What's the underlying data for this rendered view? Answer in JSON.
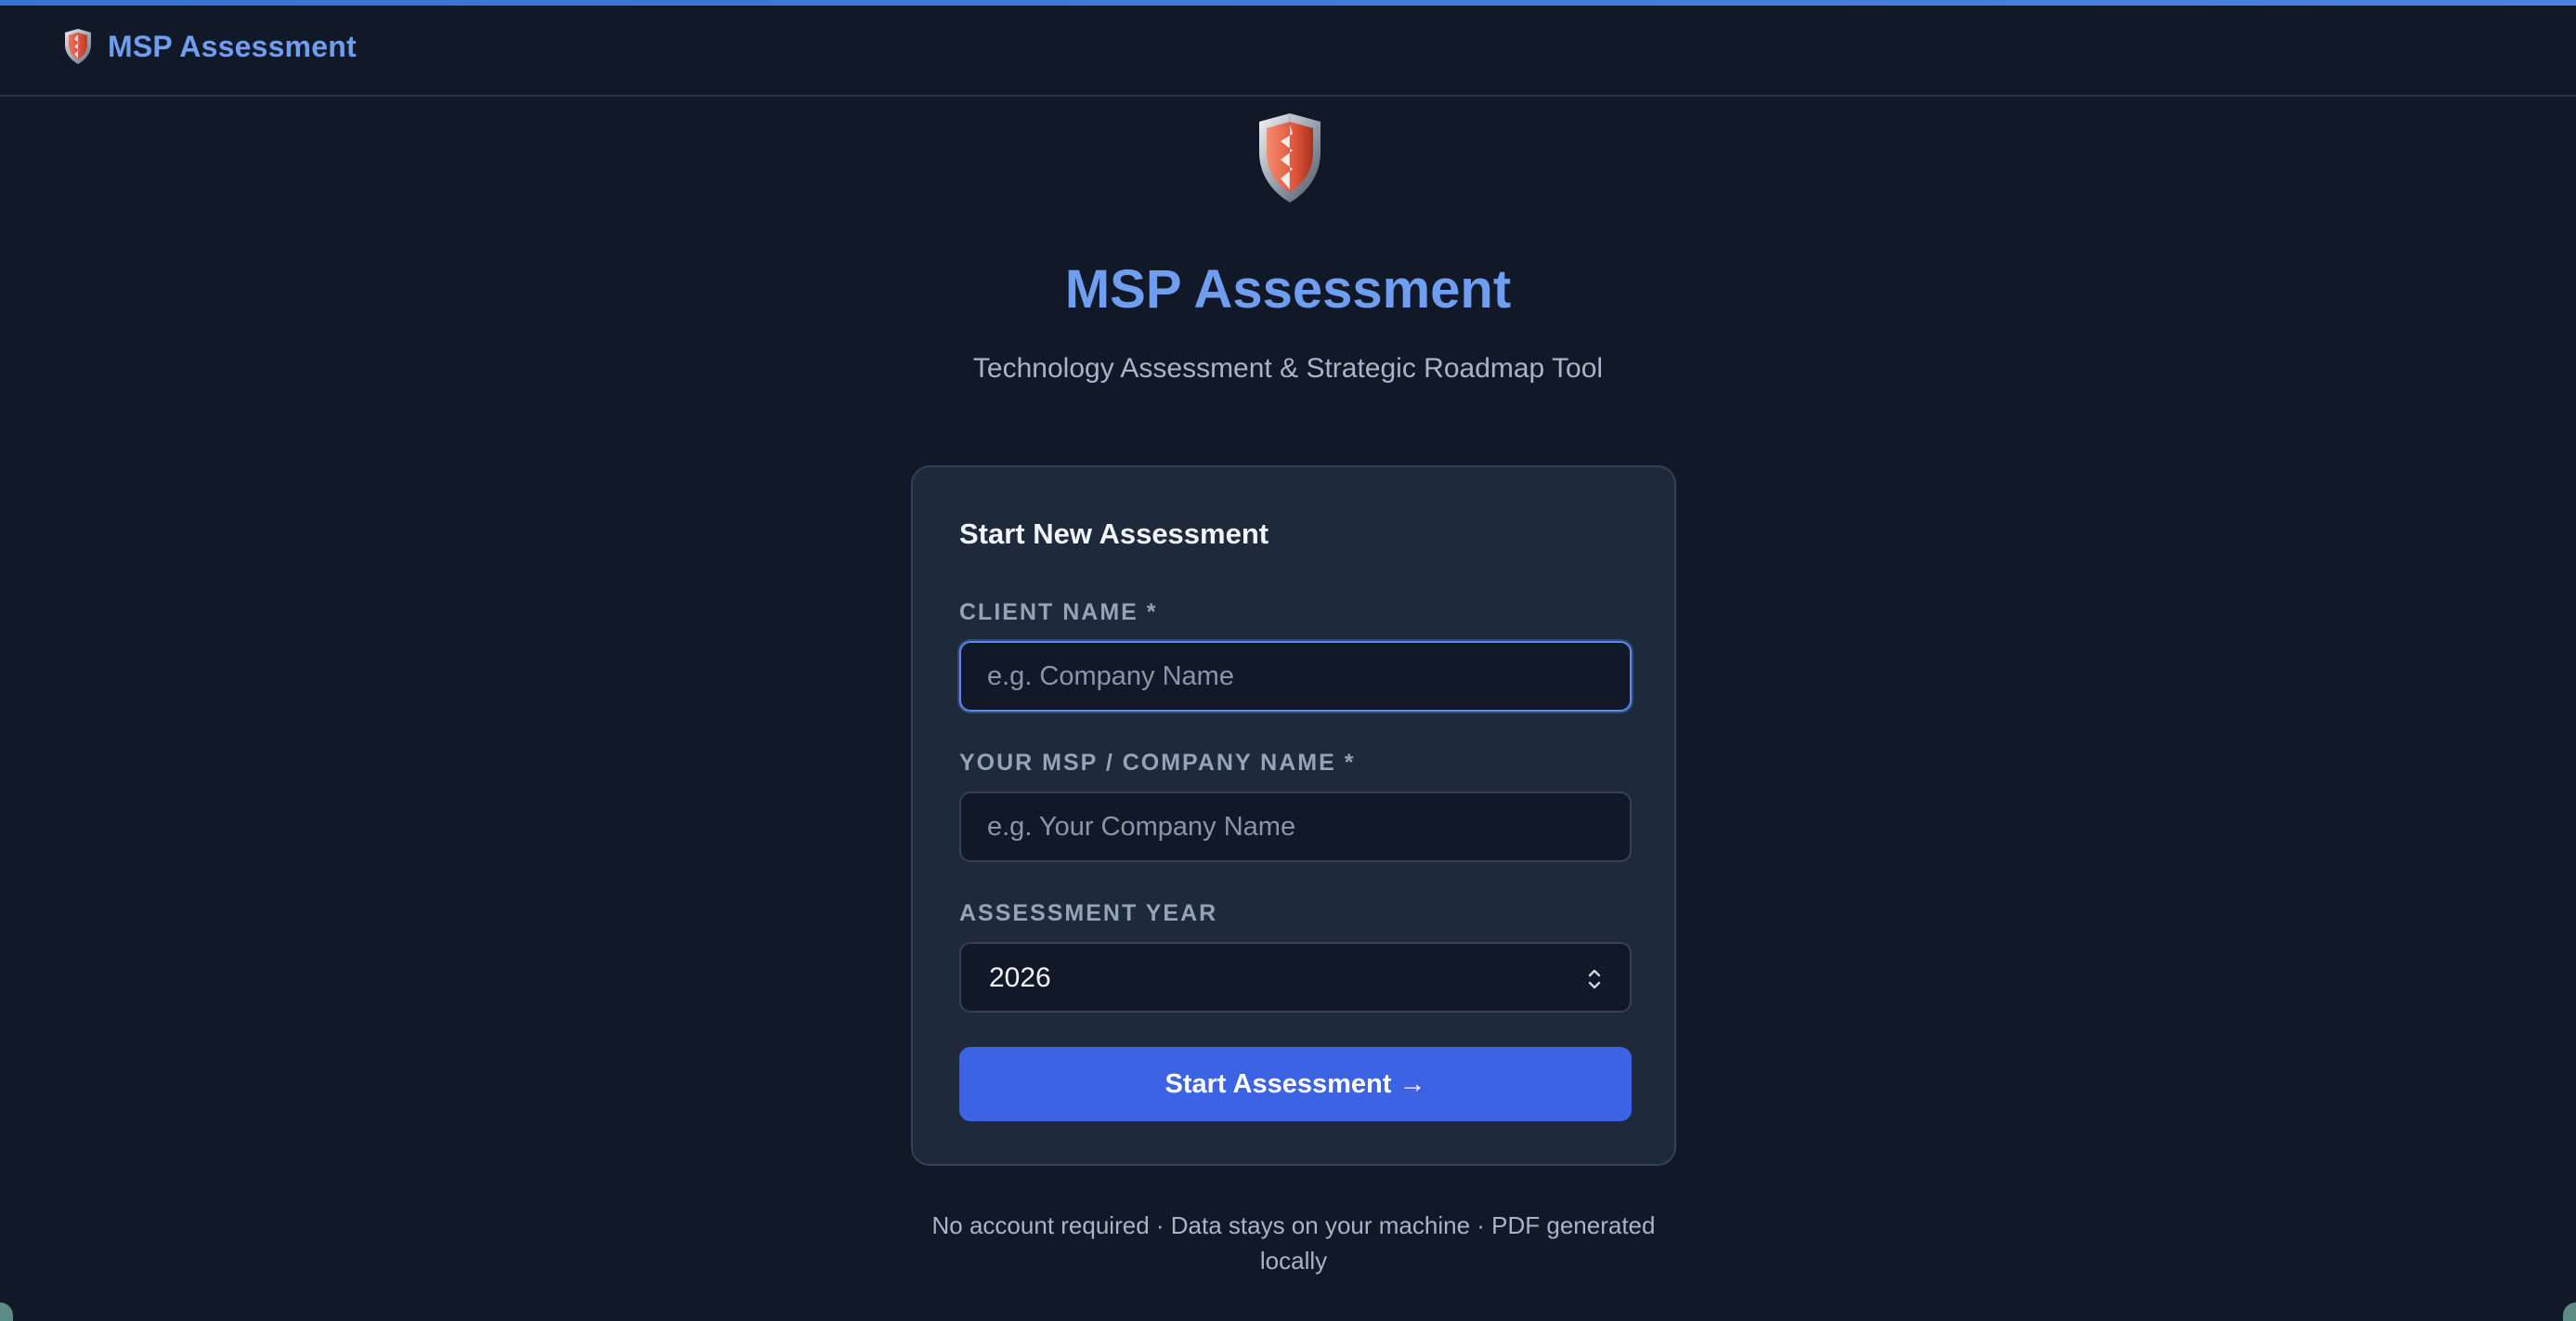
{
  "navbar": {
    "brand_icon": "shield-logo",
    "brand_title": "MSP Assessment"
  },
  "hero": {
    "logo_icon": "shield-logo",
    "title": "MSP Assessment",
    "subtitle": "Technology Assessment & Strategic Roadmap Tool"
  },
  "form": {
    "title": "Start New Assessment",
    "client_name": {
      "label": "CLIENT NAME *",
      "value": "",
      "placeholder": "e.g. Company Name"
    },
    "msp_name": {
      "label": "YOUR MSP / COMPANY NAME *",
      "value": "",
      "placeholder": "e.g. Your Company Name"
    },
    "assessment_year": {
      "label": "ASSESSMENT YEAR",
      "selected": "2026"
    },
    "submit_label": "Start Assessment →"
  },
  "footer": {
    "note": "No account required · Data stays on your machine · PDF generated locally"
  },
  "colors": {
    "background": "#111827",
    "accent": "#6f9ef0",
    "card": "#1e293b",
    "button": "#3b63e3"
  }
}
